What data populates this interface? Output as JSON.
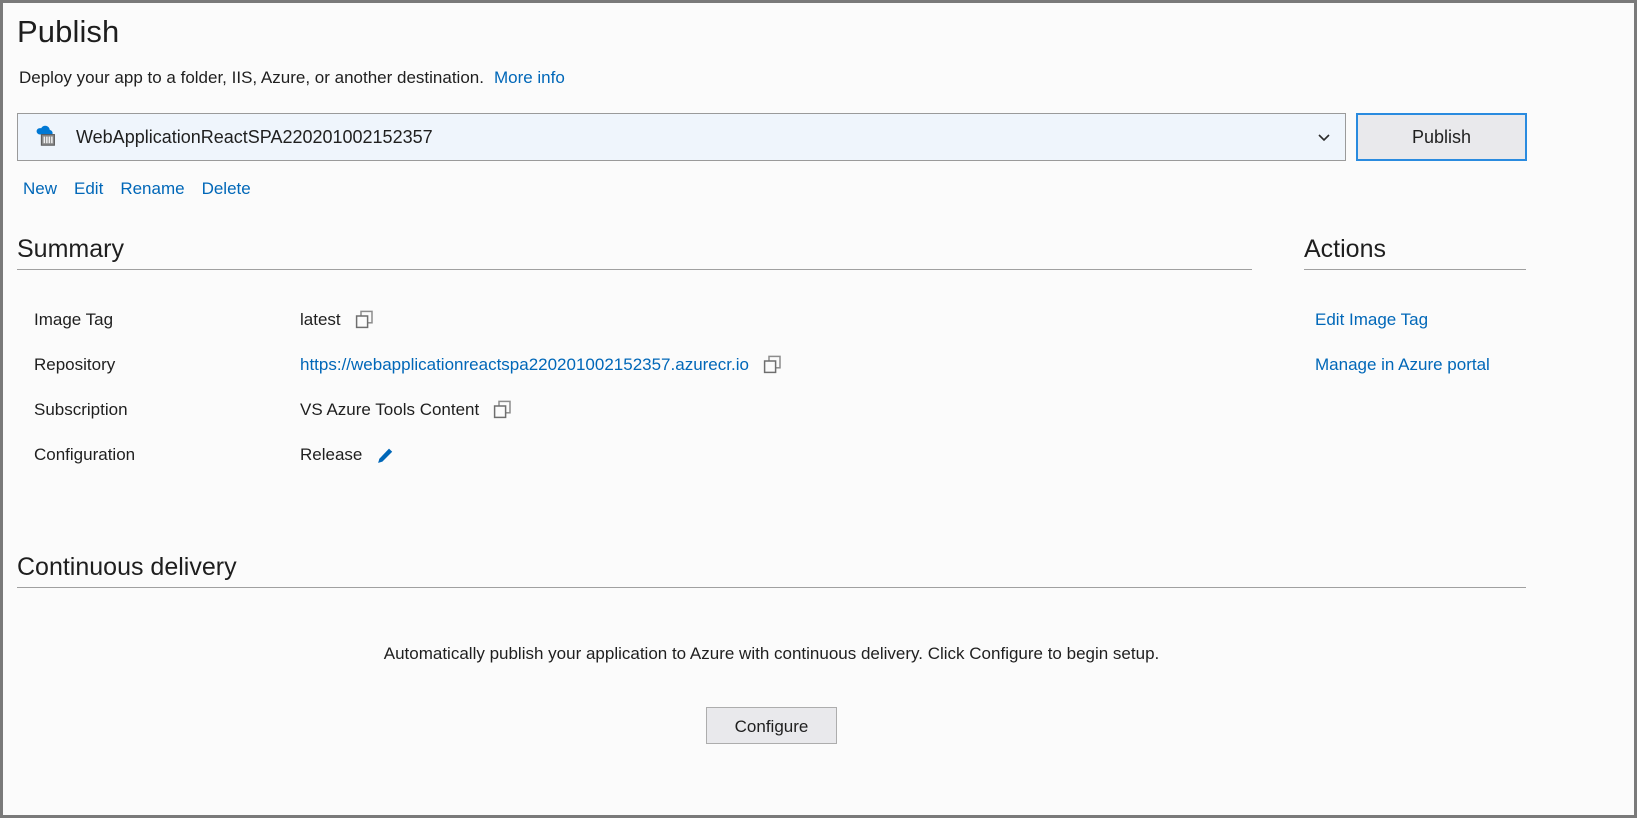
{
  "header": {
    "title": "Publish",
    "subtitle": "Deploy your app to a folder, IIS, Azure, or another destination.",
    "more_info_label": "More info"
  },
  "profile": {
    "selected_name": "WebApplicationReactSPA220201002152357",
    "icon": "container-registry-icon",
    "dropdown_icon": "chevron-down-icon",
    "publish_button_label": "Publish",
    "links": [
      {
        "label": "New",
        "name": "new-profile-link"
      },
      {
        "label": "Edit",
        "name": "edit-profile-link"
      },
      {
        "label": "Rename",
        "name": "rename-profile-link"
      },
      {
        "label": "Delete",
        "name": "delete-profile-link"
      }
    ]
  },
  "summary": {
    "heading": "Summary",
    "rows": [
      {
        "label": "Image Tag",
        "value": "latest",
        "is_link": false,
        "trailing_icon": "copy-icon"
      },
      {
        "label": "Repository",
        "value": "https://webapplicationreactspa220201002152357.azurecr.io",
        "is_link": true,
        "trailing_icon": "copy-icon"
      },
      {
        "label": "Subscription",
        "value": "VS Azure Tools Content",
        "is_link": false,
        "trailing_icon": "copy-icon"
      },
      {
        "label": "Configuration",
        "value": "Release",
        "is_link": false,
        "trailing_icon": "pencil-edit-icon"
      }
    ]
  },
  "actions": {
    "heading": "Actions",
    "items": [
      {
        "label": "Edit Image Tag",
        "name": "edit-image-tag-action"
      },
      {
        "label": "Manage in Azure portal",
        "name": "manage-in-azure-portal-action"
      }
    ]
  },
  "continuous_delivery": {
    "heading": "Continuous delivery",
    "description": "Automatically publish your application to Azure with continuous delivery. Click Configure to begin setup.",
    "configure_button_label": "Configure"
  },
  "colors": {
    "link": "#0067b8",
    "accent_border": "#2a8bdf",
    "text": "#1f1f1f",
    "panel_bg": "#fbfbfb",
    "select_bg": "#eff5fc",
    "button_bg": "#e9e9ec",
    "rule": "#a0a0a0",
    "window_border": "#7a7a7a"
  }
}
